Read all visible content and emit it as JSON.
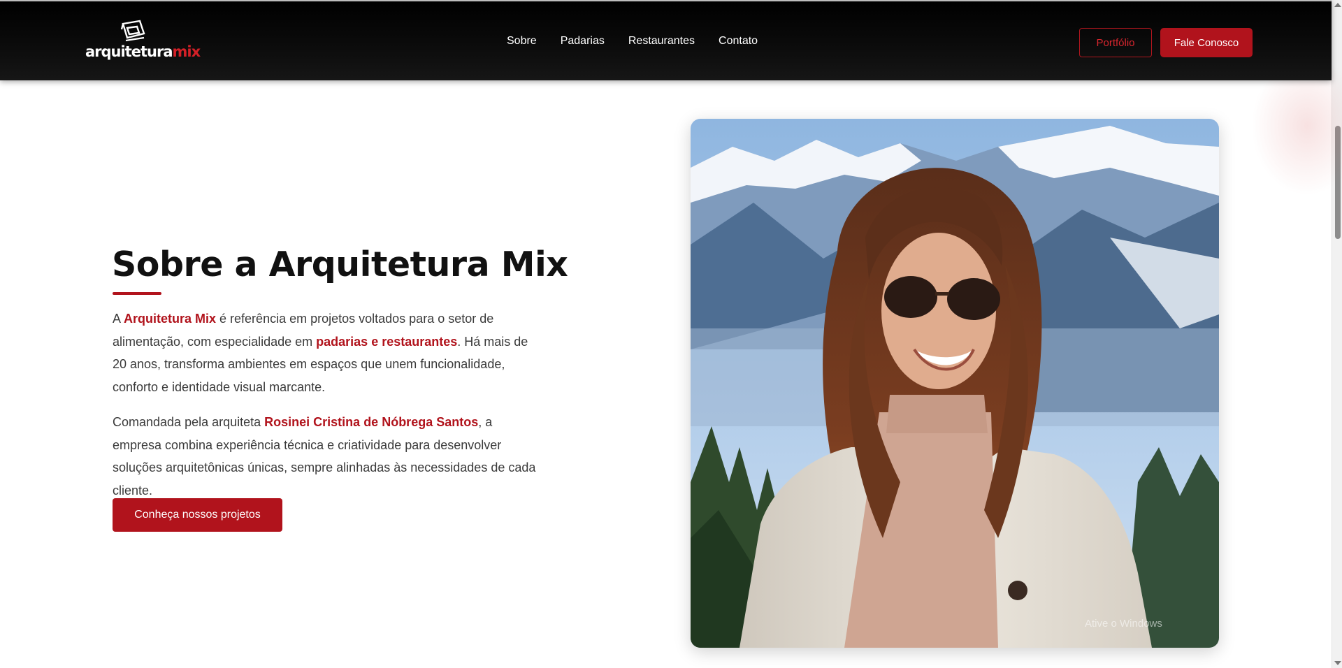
{
  "brand": {
    "logo_text_white": "arquitetura",
    "logo_text_red": "mix",
    "accent": "#b1131c"
  },
  "nav": {
    "links": [
      "Sobre",
      "Padarias",
      "Restaurantes",
      "Contato"
    ],
    "portfolio_label": "Portfólio",
    "contact_label": "Fale Conosco"
  },
  "about": {
    "title": "Sobre a Arquitetura Mix",
    "p1": {
      "a": "A ",
      "b": "Arquitetura Mix",
      "c": " é referência em projetos voltados para o setor de alimentação, com especialidade em ",
      "d": "padarias e restaurantes",
      "e": ". Há mais de 20 anos, transforma ambientes em espaços que unem funcionalidade, conforto e identidade visual marcante."
    },
    "p2": {
      "a": "Comandada pela arquiteta ",
      "b": "Rosinei Cristina de Nóbrega Santos",
      "c": ", a empresa combina experiência técnica e criatividade para desenvolver soluções arquitetônicas únicas, sempre alinhadas às necessidades de cada cliente."
    },
    "cta_label": "Conheça nossos projetos"
  },
  "photo": {
    "icon": "portrait-photo"
  },
  "overlay": {
    "watermark": "Ative o Windows"
  }
}
